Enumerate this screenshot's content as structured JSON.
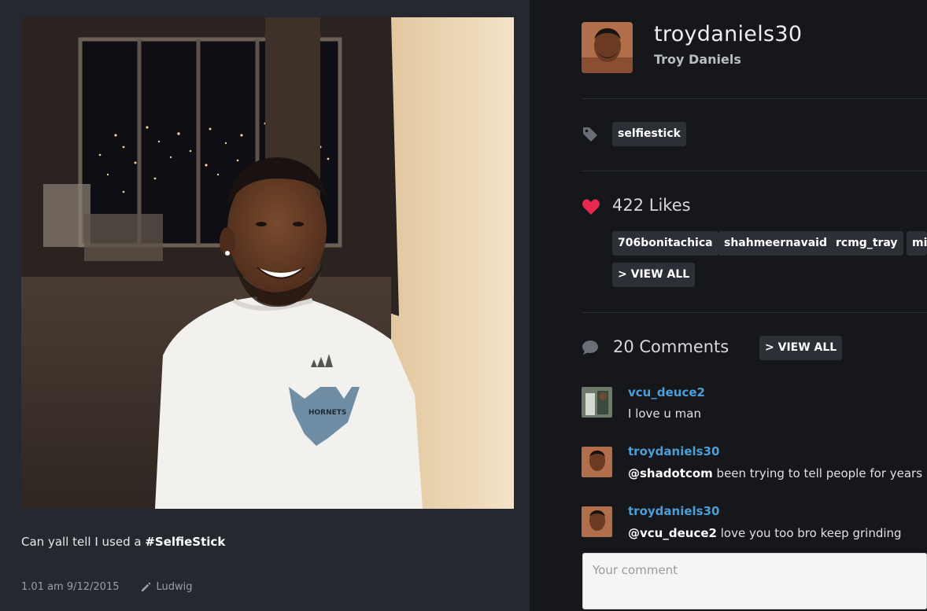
{
  "post": {
    "caption_text": "Can yall tell I used a ",
    "caption_hashtag": "#SelfieStick",
    "timestamp": "1.01 am 9/12/2015",
    "filter": "Ludwig"
  },
  "profile": {
    "username": "troydaniels30",
    "full_name": "Troy Daniels"
  },
  "tags": [
    "selfiestick"
  ],
  "likes": {
    "count_label": "422 Likes",
    "users": [
      "706bonitachica",
      "shahmeernavaid",
      "rcmg_tray",
      "mi"
    ],
    "view_all_label": "> VIEW ALL"
  },
  "comments": {
    "count_label": "20 Comments",
    "view_all_label": "> VIEW ALL",
    "items": [
      {
        "user": "vcu_deuce2",
        "mention": "",
        "text": "I love u man"
      },
      {
        "user": "troydaniels30",
        "mention": "@shadotcom",
        "text": " been trying to tell people for years"
      },
      {
        "user": "troydaniels30",
        "mention": "@vcu_deuce2",
        "text": " love you too bro keep grinding"
      }
    ],
    "input_placeholder": "Your comment"
  },
  "colors": {
    "accent_blue": "#4a9fd8",
    "heart_red": "#e8294f",
    "panel_bg": "#25282f",
    "page_bg": "#16171b"
  },
  "icons": [
    "tag-icon",
    "heart-icon",
    "comment-bubble-icon",
    "pencil-icon"
  ]
}
